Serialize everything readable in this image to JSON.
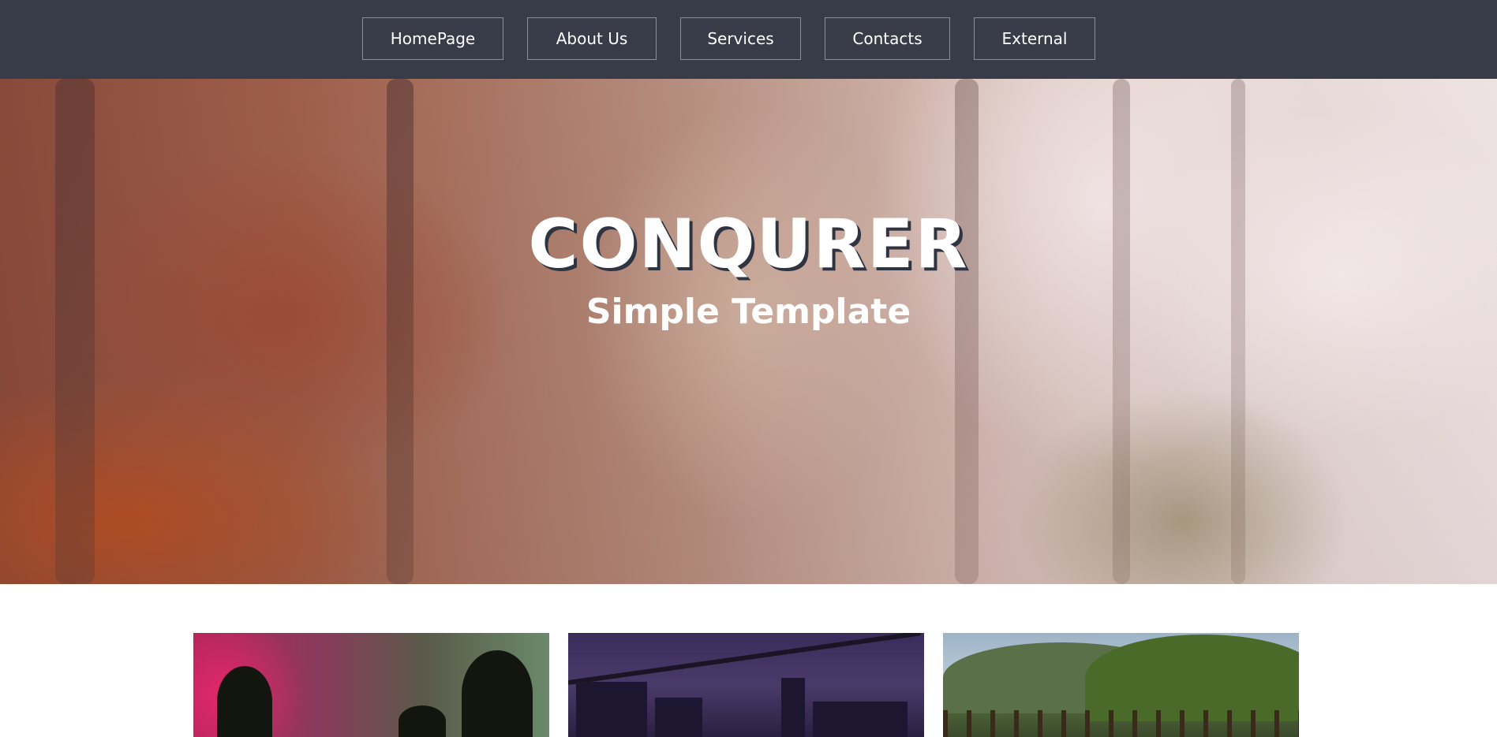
{
  "nav": {
    "items": [
      {
        "label": "HomePage"
      },
      {
        "label": "About Us"
      },
      {
        "label": "Services"
      },
      {
        "label": "Contacts"
      },
      {
        "label": "External"
      }
    ]
  },
  "hero": {
    "title": "CONQURER",
    "subtitle": "Simple Template"
  },
  "colors": {
    "navbar_bg": "#373c48",
    "nav_border": "#8a8f9a",
    "text": "#ffffff",
    "title_shadow": "#2f3440"
  }
}
